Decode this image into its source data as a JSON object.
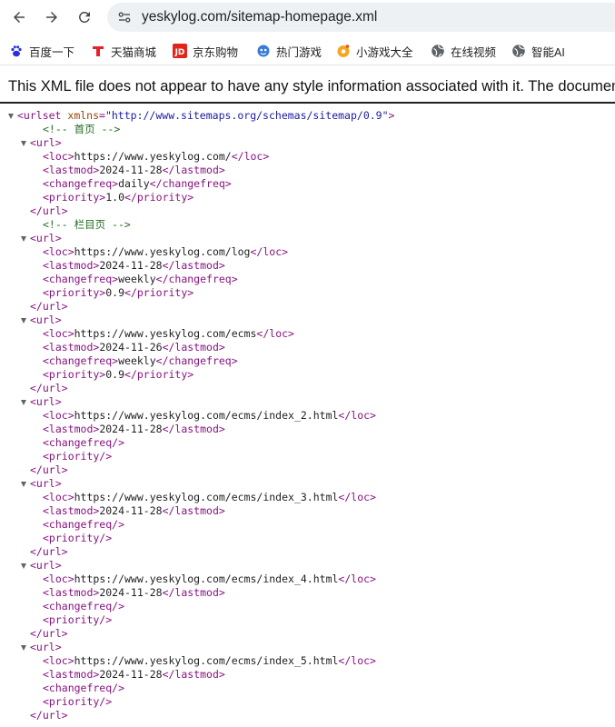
{
  "browser": {
    "url": "yeskylog.com/sitemap-homepage.xml"
  },
  "bookmarks": [
    {
      "label": "百度一下",
      "icon": "baidu-paw-icon",
      "color": "#2932e1"
    },
    {
      "label": "天猫商城",
      "icon": "tmall-icon",
      "color": "#e3202c"
    },
    {
      "label": "京东购物",
      "icon": "jd-icon",
      "color": "#e1251b"
    },
    {
      "label": "热门游戏",
      "icon": "game-mascot-icon",
      "color": "#3a7bd5"
    },
    {
      "label": "小游戏大全",
      "icon": "mini-game-icon",
      "color": "#f5a623"
    },
    {
      "label": "在线视频",
      "icon": "globe-icon",
      "color": "#5f6368"
    },
    {
      "label": "智能AI",
      "icon": "globe-icon",
      "color": "#5f6368"
    }
  ],
  "info_message": "This XML file does not appear to have any style information associated with it. The document tree is shown below.",
  "xml": {
    "root_tag": "urlset",
    "root_attr_name": "xmlns",
    "root_attr_value": "\"http://www.sitemaps.org/schemas/sitemap/0.9\"",
    "comment_home": "<!--  首页  -->",
    "comment_column": "<!--  栏目页  -->",
    "entries": [
      {
        "loc": "https://www.yeskylog.com/",
        "lastmod": "2024-11-28",
        "changefreq": "daily",
        "priority": "1.0"
      },
      {
        "loc": "https://www.yeskylog.com/log",
        "lastmod": "2024-11-28",
        "changefreq": "weekly",
        "priority": "0.9"
      },
      {
        "loc": "https://www.yeskylog.com/ecms",
        "lastmod": "2024-11-26",
        "changefreq": "weekly",
        "priority": "0.9"
      },
      {
        "loc": "https://www.yeskylog.com/ecms/index_2.html",
        "lastmod": "2024-11-28",
        "changefreq": "",
        "priority": ""
      },
      {
        "loc": "https://www.yeskylog.com/ecms/index_3.html",
        "lastmod": "2024-11-28",
        "changefreq": "",
        "priority": ""
      },
      {
        "loc": "https://www.yeskylog.com/ecms/index_4.html",
        "lastmod": "2024-11-28",
        "changefreq": "",
        "priority": ""
      },
      {
        "loc": "https://www.yeskylog.com/ecms/index_5.html",
        "lastmod": "2024-11-28",
        "changefreq": "",
        "priority": ""
      }
    ]
  }
}
